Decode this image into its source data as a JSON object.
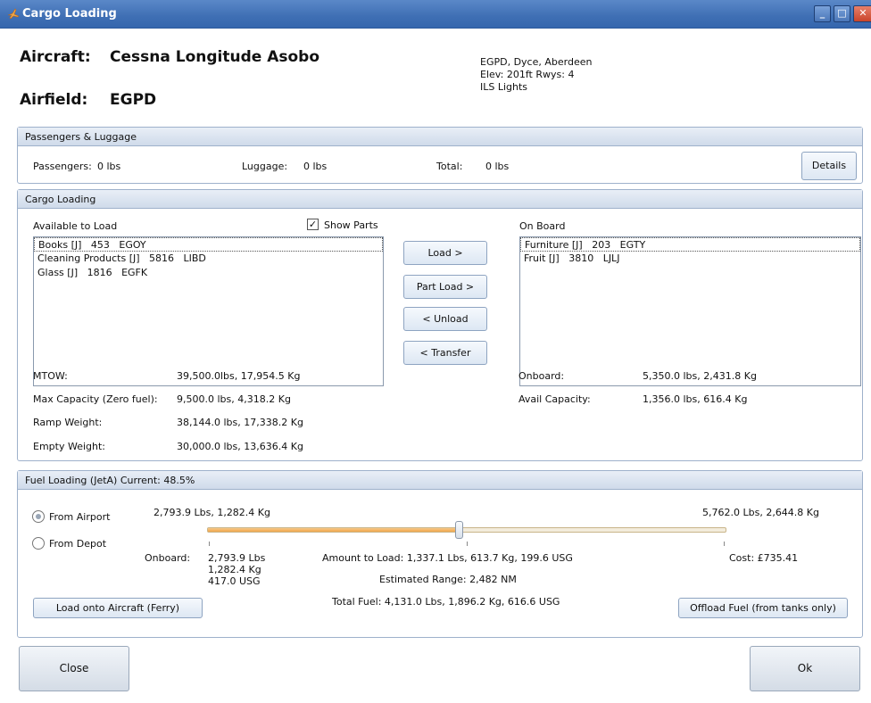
{
  "window": {
    "title": "Cargo Loading"
  },
  "header": {
    "aircraft_label": "Aircraft:",
    "aircraft_value": "Cessna Longitude Asobo",
    "airfield_label": "Airfield:",
    "airfield_value": "EGPD",
    "airfield_info": [
      "EGPD, Dyce, Aberdeen",
      "Elev: 201ft Rwys: 4",
      "ILS Lights"
    ]
  },
  "passengers": {
    "title": "Passengers & Luggage",
    "passengers_label": "Passengers:",
    "passengers_value": "0 lbs",
    "luggage_label": "Luggage:",
    "luggage_value": "0 lbs",
    "total_label": "Total:",
    "total_value": "0 lbs",
    "details_button": "Details"
  },
  "cargo": {
    "title": "Cargo Loading",
    "available_label": "Available to Load",
    "show_parts_label": "Show Parts",
    "show_parts_checked": true,
    "onboard_label": "On Board",
    "available_items": [
      "Books [J]   453   EGOY",
      "Cleaning Products [J]   5816   LIBD",
      "Glass [J]   1816   EGFK"
    ],
    "onboard_items": [
      "Furniture [J]   203   EGTY",
      "Fruit [J]   3810   LJLJ"
    ],
    "buttons": {
      "load": "Load >",
      "part_load": "Part Load >",
      "unload": "< Unload",
      "transfer": "< Transfer"
    },
    "stats_left": [
      {
        "label": "MTOW:",
        "value": "39,500.0lbs, 17,954.5 Kg"
      },
      {
        "label": "Max Capacity (Zero fuel):",
        "value": "9,500.0 lbs, 4,318.2 Kg"
      },
      {
        "label": "Ramp Weight:",
        "value": "38,144.0 lbs, 17,338.2 Kg"
      },
      {
        "label": "Empty Weight:",
        "value": "30,000.0 lbs, 13,636.4 Kg"
      }
    ],
    "stats_right": [
      {
        "label": "Onboard:",
        "value": "5,350.0 lbs, 2,431.8 Kg"
      },
      {
        "label": "Avail Capacity:",
        "value": "1,356.0 lbs, 616.4 Kg"
      }
    ]
  },
  "fuel": {
    "title": "Fuel Loading (JetA)  Current: 48.5%",
    "from_airport": "From Airport",
    "from_depot": "From Depot",
    "selected_source": "From Airport",
    "min_label": "2,793.9 Lbs, 1,282.4 Kg",
    "max_label": "5,762.0 Lbs, 2,644.8 Kg",
    "slider_fraction": 0.485,
    "onboard_label": "Onboard:",
    "onboard_lines": [
      "2,793.9 Lbs",
      "1,282.4 Kg",
      "417.0 USG"
    ],
    "amount_to_load": "Amount to Load: 1,337.1 Lbs, 613.7 Kg, 199.6 USG",
    "estimated_range": "Estimated Range: 2,482 NM",
    "total_fuel": "Total Fuel: 4,131.0 Lbs, 1,896.2 Kg, 616.6 USG",
    "cost": "Cost:  £735.41",
    "load_button": "Load onto Aircraft (Ferry)",
    "offload_button": "Offload Fuel (from tanks only)"
  },
  "footer": {
    "close_button": "Close",
    "ok_button": "Ok"
  },
  "colors": {
    "titlebar": "#3f6fb4",
    "panel_header": "#d8e3f0",
    "slider_fill": "#f0a64a"
  }
}
